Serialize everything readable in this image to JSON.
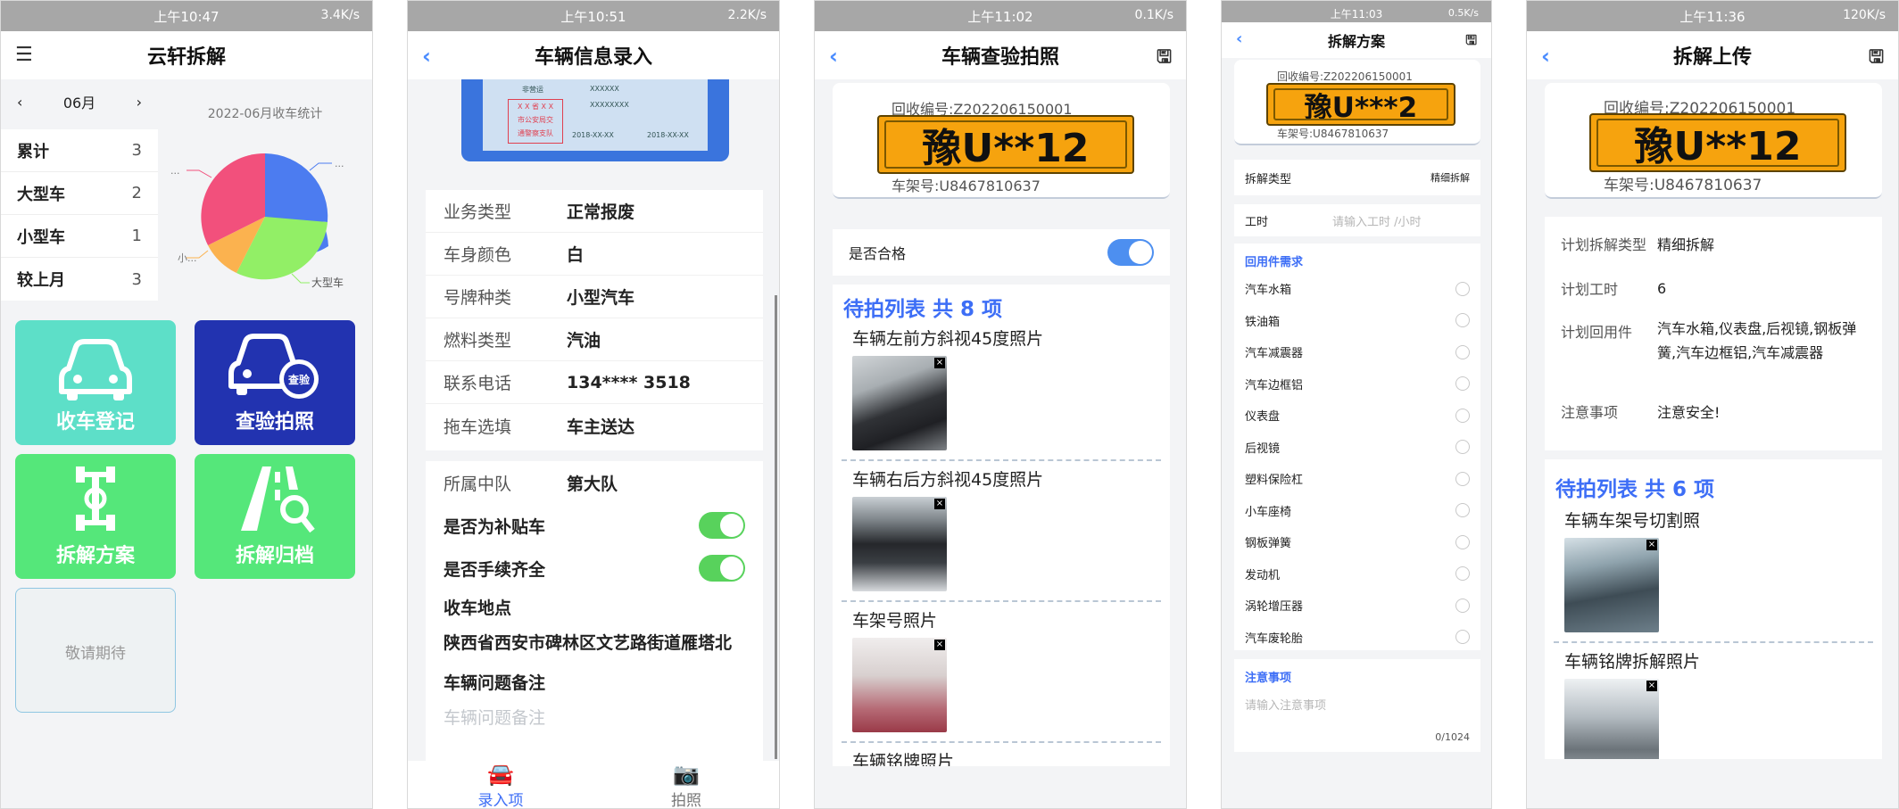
{
  "screens": [
    {
      "status_time": "上午10:47",
      "status_net": "3.4K/s",
      "title": "云轩拆解",
      "month": "06月",
      "stats": [
        {
          "label": "累计",
          "value": "3"
        },
        {
          "label": "大型车",
          "value": "2"
        },
        {
          "label": "小型车",
          "value": "1"
        },
        {
          "label": "较上月",
          "value": "3"
        }
      ],
      "chart_title": "2022-06月收车统计",
      "chart_labels": [
        "...",
        "...",
        "小...",
        "大型车"
      ],
      "tiles": [
        "收车登记",
        "查验拍照",
        "拆解方案",
        "拆解归档"
      ],
      "tile_badge": "查验",
      "placeholder": "敬请期待",
      "colors": {
        "tile_teal": "#5ddfc8",
        "tile_navy": "#2233b0",
        "tile_green": "#55e77a",
        "pie_blue": "#4c7cf0",
        "pie_green": "#92ef66",
        "pie_orange": "#fbb24f",
        "pie_pink": "#f2507c"
      }
    },
    {
      "status_time": "上午10:51",
      "status_net": "2.2K/s",
      "title": "车辆信息录入",
      "card_texts": [
        "非营运",
        "XXXXXX",
        "XXXXXXXX",
        "X X 省 X X",
        "市公安局交",
        "通警察支队",
        "2018-XX-XX",
        "2018-XX-XX"
      ],
      "fields": [
        {
          "label": "业务类型",
          "value": "正常报废"
        },
        {
          "label": "车身颜色",
          "value": "白"
        },
        {
          "label": "号牌种类",
          "value": "小型汽车"
        },
        {
          "label": "燃料类型",
          "value": "汽油"
        },
        {
          "label": "联系电话",
          "value": "134**** 3518"
        },
        {
          "label": "拖车选填",
          "value": "车主送达"
        }
      ],
      "fields2": [
        {
          "label": "所属中队",
          "value": "第大队"
        }
      ],
      "switch1": "是否为补贴车",
      "switch2": "是否手续齐全",
      "location_label": "收车地点",
      "location_value": "陕西省西安市碑林区文艺路街道雁塔北",
      "remark_label": "车辆问题备注",
      "remark_placeholder": "车辆问题备注",
      "tab_input": "录入项",
      "tab_photo": "拍照"
    },
    {
      "status_time": "上午11:02",
      "status_net": "0.1K/s",
      "title": "车辆查验拍照",
      "recycle_no": "回收编号:Z202206150001",
      "plate": "豫U**12",
      "frame_no": "车架号:U8467810637",
      "qualified_label": "是否合格",
      "list_title": "待拍列表 共 8 项",
      "items": [
        "车辆左前方斜视45度照片",
        "车辆右后方斜视45度照片",
        "车架号照片",
        "车辆铭牌照片"
      ]
    },
    {
      "status_time": "上午11:03",
      "status_net": "0.5K/s",
      "title": "拆解方案",
      "recycle_no": "回收编号:Z202206150001",
      "plate": "豫U***2",
      "frame_no": "车架号:U8467810637",
      "type_label": "拆解类型",
      "type_value": "精细拆解",
      "hours_label": "工时",
      "hours_placeholder": "请输入工时 /小时",
      "parts_title": "回用件需求",
      "parts": [
        "汽车水箱",
        "铁油箱",
        "汽车减震器",
        "汽车边框铝",
        "仪表盘",
        "后视镜",
        "塑料保险杠",
        "小车座椅",
        "钢板弹簧",
        "发动机",
        "涡轮增压器",
        "汽车废轮胎"
      ],
      "notes_title": "注意事项",
      "notes_placeholder": "请输入注意事项",
      "notes_count": "0/1024"
    },
    {
      "status_time": "上午11:36",
      "status_net": "120K/s",
      "title": "拆解上传",
      "recycle_no": "回收编号:Z202206150001",
      "plate": "豫U**12",
      "frame_no": "车架号:U8467810637",
      "fields": [
        {
          "label": "计划拆解类型",
          "value": "精细拆解"
        },
        {
          "label": "计划工时",
          "value": "6"
        },
        {
          "label": "计划回用件",
          "value": "汽车水箱,仪表盘,后视镜,钢板弹簧,汽车边框铝,汽车减震器"
        },
        {
          "label": "注意事项",
          "value": "注意安全!"
        }
      ],
      "list_title": "待拍列表 共 6 项",
      "items": [
        "车辆车架号切割照",
        "车辆铭牌拆解照片"
      ]
    }
  ]
}
